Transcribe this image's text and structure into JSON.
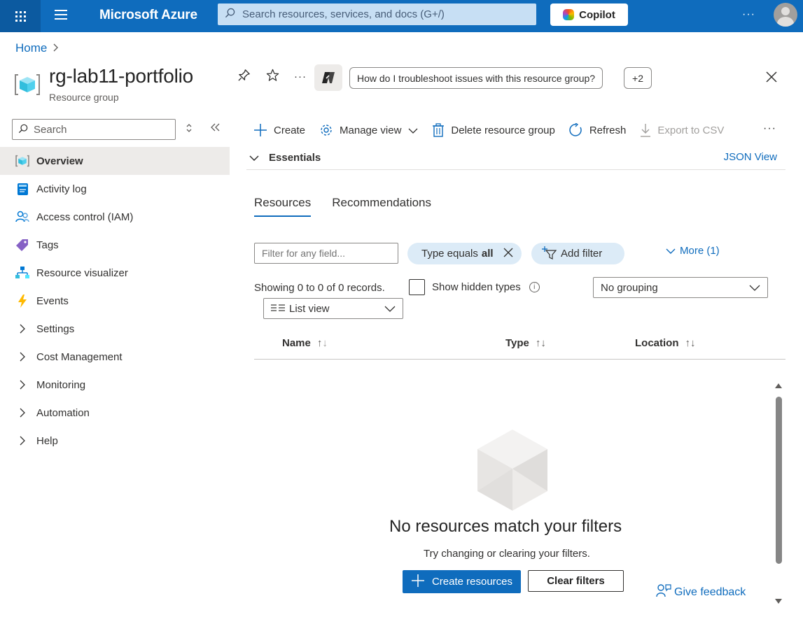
{
  "topbar": {
    "brand": "Microsoft Azure",
    "search_placeholder": "Search resources, services, and docs (G+/)",
    "copilot_label": "Copilot",
    "more": "···"
  },
  "breadcrumb": {
    "home": "Home"
  },
  "header": {
    "title": "rg-lab11-portfolio",
    "subtitle": "Resource group",
    "suggestion": "How do I troubleshoot issues with this resource group?",
    "more_suggestions": "+2",
    "more": "···"
  },
  "nav": {
    "search_placeholder": "Search",
    "items": [
      {
        "label": "Overview",
        "icon": "resource-group-icon",
        "active": true
      },
      {
        "label": "Activity log",
        "icon": "activity-log-icon"
      },
      {
        "label": "Access control (IAM)",
        "icon": "people-icon"
      },
      {
        "label": "Tags",
        "icon": "tag-icon"
      },
      {
        "label": "Resource visualizer",
        "icon": "visualizer-icon"
      },
      {
        "label": "Events",
        "icon": "lightning-icon"
      },
      {
        "label": "Settings",
        "icon": "chevron-right-icon"
      },
      {
        "label": "Cost Management",
        "icon": "chevron-right-icon"
      },
      {
        "label": "Monitoring",
        "icon": "chevron-right-icon"
      },
      {
        "label": "Automation",
        "icon": "chevron-right-icon"
      },
      {
        "label": "Help",
        "icon": "chevron-right-icon"
      }
    ]
  },
  "commands": {
    "create": "Create",
    "manage_view": "Manage view",
    "delete": "Delete resource group",
    "refresh": "Refresh",
    "export": "Export to CSV",
    "more": "···"
  },
  "essentials": {
    "label": "Essentials",
    "json_view": "JSON View"
  },
  "tabs": {
    "resources": "Resources",
    "recommendations": "Recommendations"
  },
  "filters": {
    "field_placeholder": "Filter for any field...",
    "type_pill_prefix": "Type equals",
    "type_pill_value": "all",
    "add_filter": "Add filter",
    "more": "More (1)"
  },
  "records": {
    "summary": "Showing 0 to 0 of 0 records.",
    "show_hidden": "Show hidden types",
    "grouping": "No grouping",
    "view": "List view"
  },
  "table": {
    "columns": [
      "Name",
      "Type",
      "Location"
    ]
  },
  "empty": {
    "title": "No resources match your filters",
    "subtitle": "Try changing or clearing your filters.",
    "create_button": "Create resources",
    "clear_button": "Clear filters"
  },
  "feedback": "Give feedback",
  "colors": {
    "accent": "#0f6cbd",
    "topbar": "#0f6cbd",
    "pill": "#dcebf7"
  }
}
